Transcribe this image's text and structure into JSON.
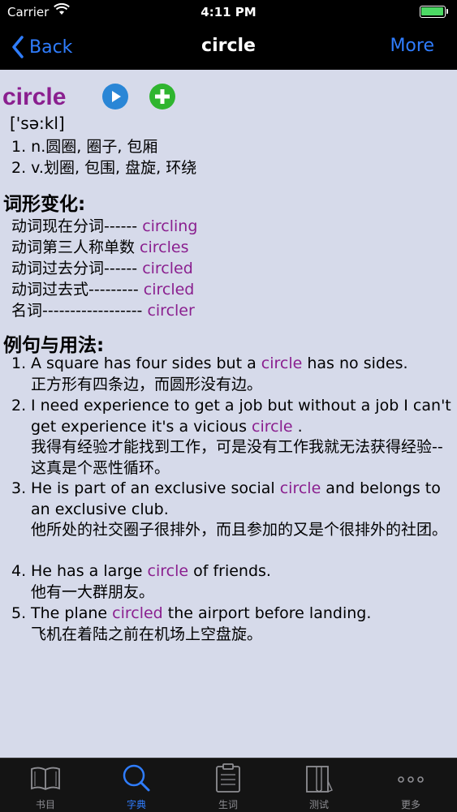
{
  "status_bar": {
    "carrier": "Carrier",
    "time": "4:11 PM"
  },
  "nav": {
    "back_label": "Back",
    "title": "circle",
    "more_label": "More"
  },
  "entry": {
    "headword": "circle",
    "phonetic": "['sə:kl]",
    "definitions": [
      "1. n.圆圈, 圈子, 包厢",
      "2. v.划圈, 包围, 盘旋, 环绕"
    ]
  },
  "forms": {
    "title": "词形变化:",
    "rows": [
      {
        "label": "动词现在分词------ ",
        "value": "circling"
      },
      {
        "label": "动词第三人称单数 ",
        "value": "circles"
      },
      {
        "label": "动词过去分词------ ",
        "value": "circled"
      },
      {
        "label": "动词过去式--------- ",
        "value": "circled"
      },
      {
        "label": "名词------------------ ",
        "value": "circler"
      }
    ]
  },
  "examples": {
    "title": "例句与用法:",
    "items": [
      {
        "num": "1.",
        "before": "A square has four sides but a ",
        "word": "circle",
        "after": " has no sides.",
        "zh": "正方形有四条边，而圆形没有边。"
      },
      {
        "num": "2.",
        "before": "I need experience to get a job but without a job I can't get experience it's a vicious ",
        "word": "circle",
        "after": " .",
        "zh": "我得有经验才能找到工作，可是没有工作我就无法获得经验--这真是个恶性循环。"
      },
      {
        "num": "3.",
        "before": "He is part of an exclusive social ",
        "word": "circle",
        "after": " and belongs to an exclusive club.",
        "zh": "他所处的社交圈子很排外，而且参加的又是个很排外的社团。"
      },
      {
        "num": "4.",
        "before": "He has a large ",
        "word": "circle",
        "after": " of friends.",
        "zh": "他有一大群朋友。"
      },
      {
        "num": "5.",
        "before": "The plane ",
        "word": "circled",
        "after": " the airport before landing.",
        "zh": "飞机在着陆之前在机场上空盘旋。"
      }
    ]
  },
  "tabbar": {
    "items": [
      {
        "label": "书目",
        "icon": "book-icon"
      },
      {
        "label": "字典",
        "icon": "search-icon"
      },
      {
        "label": "生词",
        "icon": "clipboard-icon"
      },
      {
        "label": "测试",
        "icon": "test-icon"
      },
      {
        "label": "更多",
        "icon": "more-icon"
      }
    ],
    "active_index": 1
  },
  "colors": {
    "accent": "#2f7dff",
    "headword": "#8a1f8f",
    "background": "#d6daea"
  }
}
